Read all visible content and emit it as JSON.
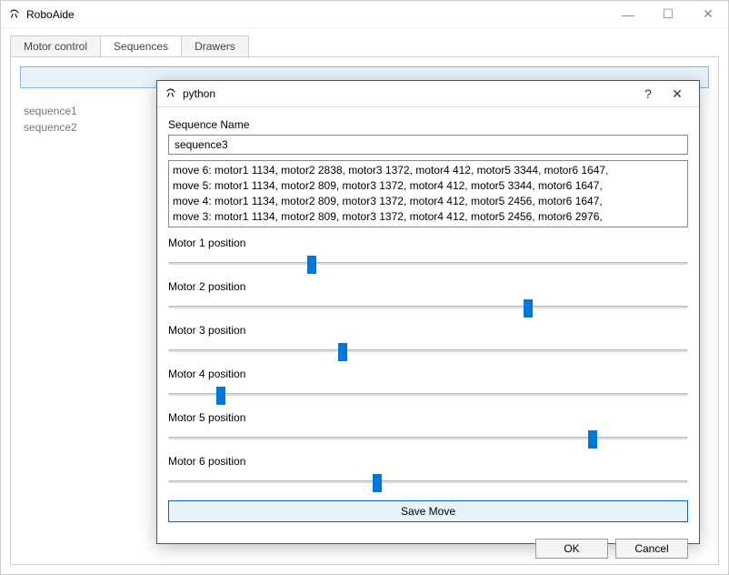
{
  "app": {
    "title": "RoboAide",
    "tabs": [
      "Motor control",
      "Sequences",
      "Drawers"
    ],
    "active_tab_index": 1,
    "sequences": [
      "sequence1",
      "sequence2"
    ]
  },
  "dialog": {
    "title": "python",
    "seq_name_label": "Sequence Name",
    "seq_name_value": "sequence3",
    "moves": [
      "move 6: motor1 1134, motor2 2838, motor3 1372, motor4 412, motor5 3344, motor6 1647,",
      "move 5: motor1 1134, motor2 809, motor3 1372, motor4 412, motor5 3344, motor6 1647,",
      "move 4: motor1 1134, motor2 809, motor3 1372, motor4 412, motor5 2456, motor6 1647,",
      "move 3: motor1 1134, motor2 809, motor3 1372, motor4 412, motor5 2456, motor6 2976,"
    ],
    "motors": [
      {
        "label": "Motor 1 position",
        "value": 1134,
        "max": 4095
      },
      {
        "label": "Motor 2 position",
        "value": 2838,
        "max": 4095
      },
      {
        "label": "Motor 3 position",
        "value": 1372,
        "max": 4095
      },
      {
        "label": "Motor 4 position",
        "value": 412,
        "max": 4095
      },
      {
        "label": "Motor 5 position",
        "value": 3344,
        "max": 4095
      },
      {
        "label": "Motor 6 position",
        "value": 1647,
        "max": 4095
      }
    ],
    "save_move_label": "Save Move",
    "ok_label": "OK",
    "cancel_label": "Cancel"
  }
}
